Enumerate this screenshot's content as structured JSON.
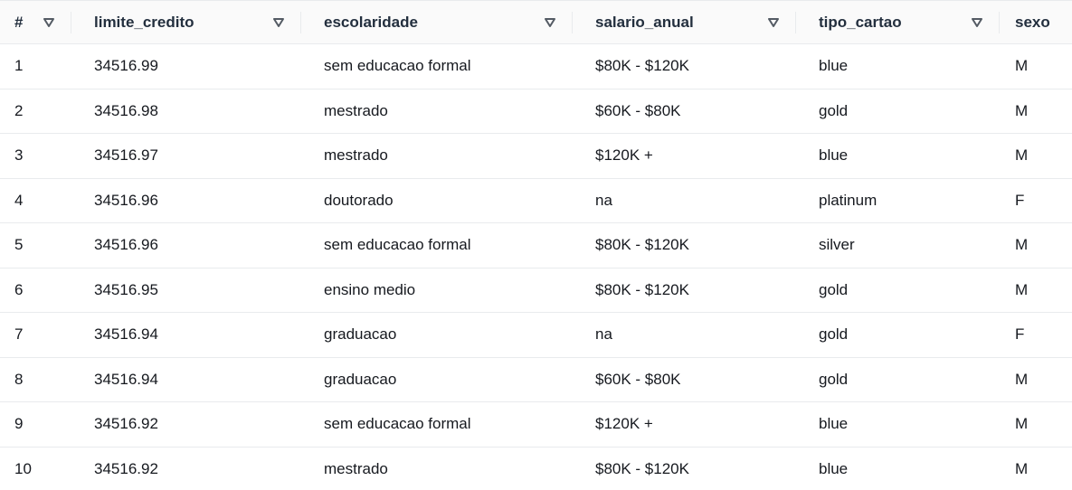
{
  "table": {
    "columns": [
      {
        "label": "#"
      },
      {
        "label": "limite_credito"
      },
      {
        "label": "escolaridade"
      },
      {
        "label": "salario_anual"
      },
      {
        "label": "tipo_cartao"
      },
      {
        "label": "sexo"
      }
    ],
    "rows": [
      {
        "idx": "1",
        "limite_credito": "34516.99",
        "escolaridade": "sem educacao formal",
        "salario_anual": "$80K - $120K",
        "tipo_cartao": "blue",
        "sexo": "M"
      },
      {
        "idx": "2",
        "limite_credito": "34516.98",
        "escolaridade": "mestrado",
        "salario_anual": "$60K - $80K",
        "tipo_cartao": "gold",
        "sexo": "M"
      },
      {
        "idx": "3",
        "limite_credito": "34516.97",
        "escolaridade": "mestrado",
        "salario_anual": "$120K +",
        "tipo_cartao": "blue",
        "sexo": "M"
      },
      {
        "idx": "4",
        "limite_credito": "34516.96",
        "escolaridade": "doutorado",
        "salario_anual": "na",
        "tipo_cartao": "platinum",
        "sexo": "F"
      },
      {
        "idx": "5",
        "limite_credito": "34516.96",
        "escolaridade": "sem educacao formal",
        "salario_anual": "$80K - $120K",
        "tipo_cartao": "silver",
        "sexo": "M"
      },
      {
        "idx": "6",
        "limite_credito": "34516.95",
        "escolaridade": "ensino medio",
        "salario_anual": "$80K - $120K",
        "tipo_cartao": "gold",
        "sexo": "M"
      },
      {
        "idx": "7",
        "limite_credito": "34516.94",
        "escolaridade": "graduacao",
        "salario_anual": "na",
        "tipo_cartao": "gold",
        "sexo": "F"
      },
      {
        "idx": "8",
        "limite_credito": "34516.94",
        "escolaridade": "graduacao",
        "salario_anual": "$60K - $80K",
        "tipo_cartao": "gold",
        "sexo": "M"
      },
      {
        "idx": "9",
        "limite_credito": "34516.92",
        "escolaridade": "sem educacao formal",
        "salario_anual": "$120K +",
        "tipo_cartao": "blue",
        "sexo": "M"
      },
      {
        "idx": "10",
        "limite_credito": "34516.92",
        "escolaridade": "mestrado",
        "salario_anual": "$80K - $120K",
        "tipo_cartao": "blue",
        "sexo": "M"
      }
    ]
  },
  "icons": {
    "sort": "sort-triangle-down-icon"
  },
  "colors": {
    "header_bg": "#fafafa",
    "border": "#e9ebed",
    "text": "#16191f",
    "icon": "#545b64"
  }
}
